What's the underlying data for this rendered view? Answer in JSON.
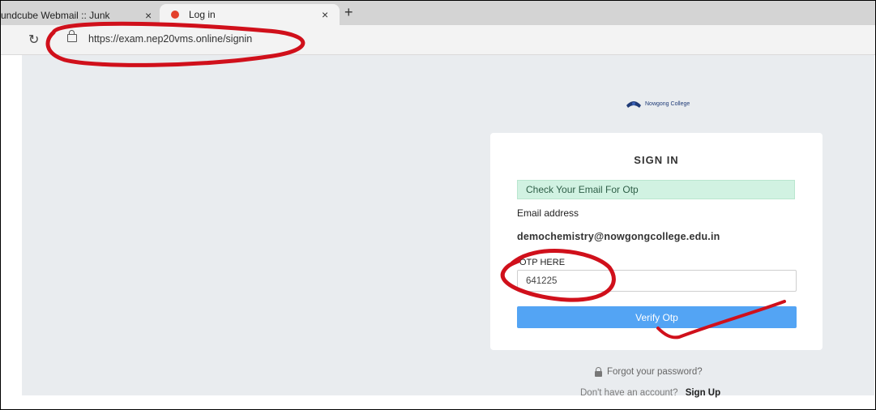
{
  "browser": {
    "tabs": [
      {
        "label": "undcube Webmail :: Junk",
        "close": "×"
      },
      {
        "label": "Log in",
        "close": "×"
      }
    ],
    "new_tab": "+",
    "reload_icon": "↻",
    "url": "https://exam.nep20vms.online/signin"
  },
  "page": {
    "logo_text": "Nowgong College",
    "title": "SIGN IN",
    "alert": "Check Your Email For Otp",
    "email_label": "Email address",
    "email_value": "demochemistry@nowgongcollege.edu.in",
    "otp_label": "OTP HERE",
    "otp_value": "641225",
    "verify_button": "Verify Otp",
    "forgot_password": "Forgot your password?",
    "no_account_text": "Don't have an account?",
    "sign_up": "Sign Up"
  },
  "colors": {
    "annotation_red": "#d0101b",
    "button_blue": "#53a4f4",
    "alert_green": "#d1f2e2"
  }
}
